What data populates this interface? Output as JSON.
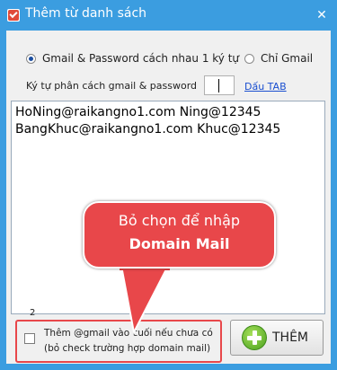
{
  "window": {
    "title": "Thêm từ danh sách",
    "close_glyph": "✕"
  },
  "options": {
    "radio_both_label": "Gmail & Password cách nhau 1 ký tự",
    "radio_gmail_only_label": "Chỉ Gmail",
    "selected": "both"
  },
  "separator": {
    "label": "Ký tự phân cách gmail & password",
    "value": "",
    "tab_link": "Dấu TAB"
  },
  "list": {
    "lines": [
      "HoNing@raikangno1.com Ning@12345",
      "BangKhuc@raikangno1.com Khuc@12345"
    ]
  },
  "callout": {
    "line1": "Bỏ chọn để nhập",
    "line2": "Domain Mail"
  },
  "count": "2",
  "gmail_option": {
    "line1": "Thêm @gmail vào cuối nếu chưa có",
    "line2": "(bỏ check trường hợp domain mail)",
    "checked": false
  },
  "add_button": {
    "label": "THÊM"
  },
  "colors": {
    "accent": "#3b9de0",
    "callout": "#e8474a",
    "link": "#1a4fd0"
  }
}
